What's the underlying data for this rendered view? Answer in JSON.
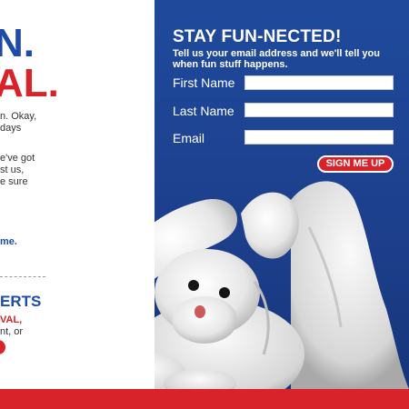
{
  "left": {
    "heading_line_1": "N.",
    "heading_line_2": "AL.",
    "p1_line1": "n. Okay,",
    "p1_line2": "days",
    "p2_line1": "e've got",
    "p2_line2": "st us,",
    "p2_line3": "e sure",
    "link_text": "me.",
    "sub_heading": "ERTS",
    "sub_red": "VAL,",
    "sub_line": "nt, or"
  },
  "signup": {
    "title": "STAY FUN-NECTED!",
    "subtitle": "Tell us your email address and we'll tell you when fun stuff happens.",
    "first_name_label": "First Name",
    "last_name_label": "Last Name",
    "email_label": "Email",
    "first_name_value": "",
    "last_name_value": "",
    "email_value": "",
    "submit_label": "SIGN ME UP"
  },
  "colors": {
    "panel_blue": "#1f4a9c",
    "accent_red": "#d8232a",
    "heading_blue": "#1f4aa8"
  },
  "icons": {
    "towel_animal": "towel-bunny-image"
  }
}
